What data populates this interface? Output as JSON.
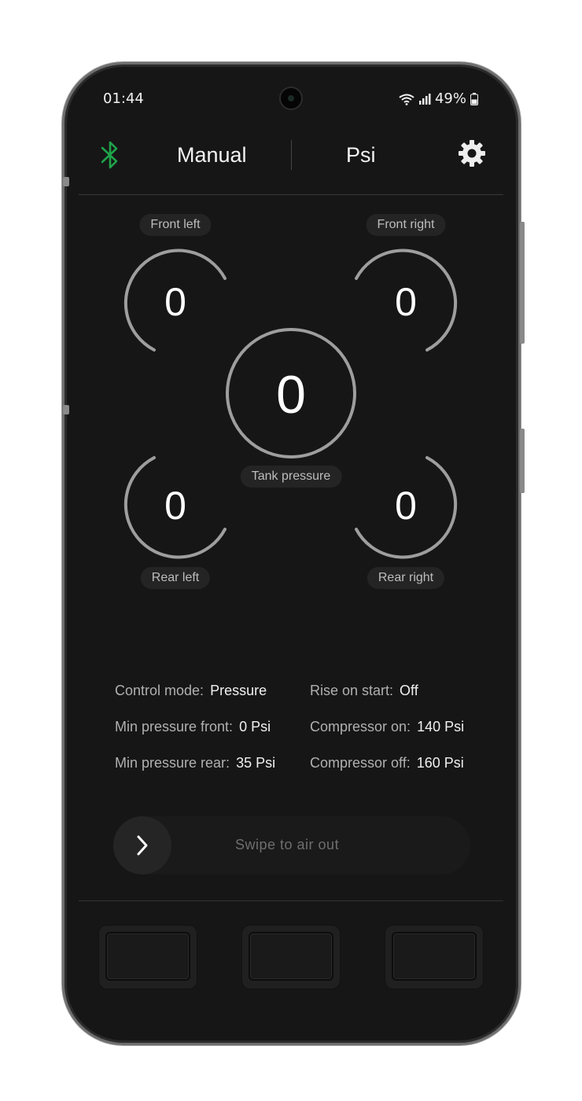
{
  "status_bar": {
    "time": "01:44",
    "battery": "49%"
  },
  "header": {
    "mode_label": "Manual",
    "unit_label": "Psi"
  },
  "gauges": {
    "front_left": {
      "label": "Front left",
      "value": "0"
    },
    "front_right": {
      "label": "Front right",
      "value": "0"
    },
    "tank": {
      "label": "Tank pressure",
      "value": "0"
    },
    "rear_left": {
      "label": "Rear left",
      "value": "0"
    },
    "rear_right": {
      "label": "Rear right",
      "value": "0"
    }
  },
  "settings": {
    "control_mode": {
      "label": "Control mode:",
      "value": "Pressure"
    },
    "rise_on_start": {
      "label": "Rise on start:",
      "value": "Off"
    },
    "min_pressure_front": {
      "label": "Min pressure front:",
      "value": "0 Psi"
    },
    "compressor_on": {
      "label": "Compressor on:",
      "value": "140 Psi"
    },
    "min_pressure_rear": {
      "label": "Min pressure rear:",
      "value": "35 Psi"
    },
    "compressor_off": {
      "label": "Compressor off:",
      "value": "160 Psi"
    }
  },
  "swipe": {
    "text": "Swipe to air out"
  },
  "colors": {
    "bluetooth": "#1fa34a",
    "background": "#161616",
    "gauge_stroke": "#9e9e9e"
  },
  "icons": {
    "bluetooth": "bluetooth-icon",
    "settings": "gear-icon",
    "swipe": "chevron-right-icon"
  }
}
